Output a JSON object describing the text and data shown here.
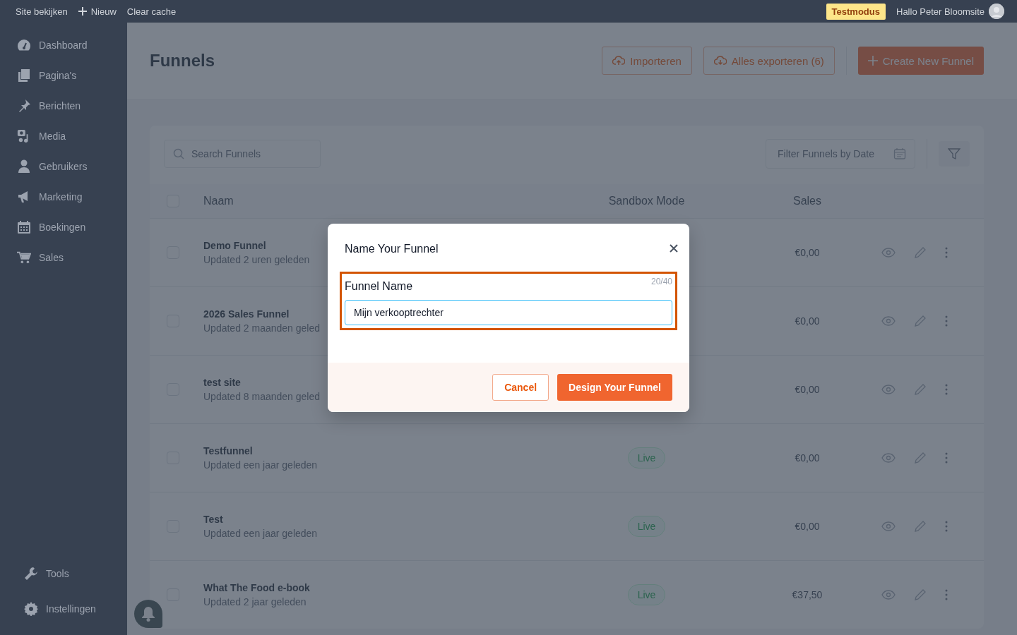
{
  "top_bar": {
    "links": [
      {
        "label": "Site bekijken",
        "kind": "link"
      },
      {
        "label": "Nieuw",
        "kind": "new"
      },
      {
        "label": "Clear cache",
        "kind": "link"
      }
    ],
    "badge": "Testmodus",
    "greeting": "Hallo Peter Bloomsite"
  },
  "sidebar": {
    "items": [
      {
        "label": "Dashboard"
      },
      {
        "label": "Pagina's"
      },
      {
        "label": "Berichten"
      },
      {
        "label": "Media"
      },
      {
        "label": "Gebruikers"
      },
      {
        "label": "Marketing"
      },
      {
        "label": "Boekingen"
      },
      {
        "label": "Sales"
      }
    ],
    "footer_items": [
      {
        "label": "Tools"
      },
      {
        "label": "Instellingen"
      }
    ]
  },
  "page": {
    "title": "Funnels",
    "actions": [
      {
        "label": "Importeren",
        "kind": "import"
      },
      {
        "label": "Alles exporteren (6)",
        "kind": "export"
      },
      {
        "label": "Create New Funnel",
        "kind": "primary"
      }
    ]
  },
  "search": {
    "placeholder": "Search Funnels"
  },
  "date_filter": {
    "placeholder": "Filter Funnels by Date"
  },
  "table": {
    "select_all_checked": false,
    "columns": [
      "Naam",
      "Sandbox Mode",
      "Sales"
    ],
    "rows": [
      {
        "name": "Demo Funnel",
        "updated": "Updated 2 uren geleden",
        "sales": "€0,00",
        "checked": false
      },
      {
        "name": "2026 Sales Funnel",
        "updated": "Updated 2 maanden geled",
        "sales": "€0,00",
        "checked": false
      },
      {
        "name": "test site",
        "updated": "Updated 8 maanden geled",
        "sales": "€0,00",
        "checked": false
      },
      {
        "name": "Testfunnel",
        "updated": "Updated een jaar geleden",
        "sandbox": "Live",
        "sales": "€0,00",
        "checked": false
      },
      {
        "name": "Test",
        "updated": "Updated een jaar geleden",
        "sandbox": "Live",
        "sales": "€0,00",
        "checked": false
      },
      {
        "name": "What The Food e-book",
        "updated": "Updated 2 jaar geleden",
        "sandbox": "Live",
        "sales": "€37,50",
        "checked": false
      }
    ]
  },
  "modal": {
    "title": "Name Your Funnel",
    "field_label": "Funnel Name",
    "counter": "20/40",
    "value": "Mijn verkooptrechter",
    "buttons": [
      {
        "label": "Cancel",
        "kind": "secondary"
      },
      {
        "label": "Design Your Funnel",
        "kind": "primary"
      }
    ]
  }
}
